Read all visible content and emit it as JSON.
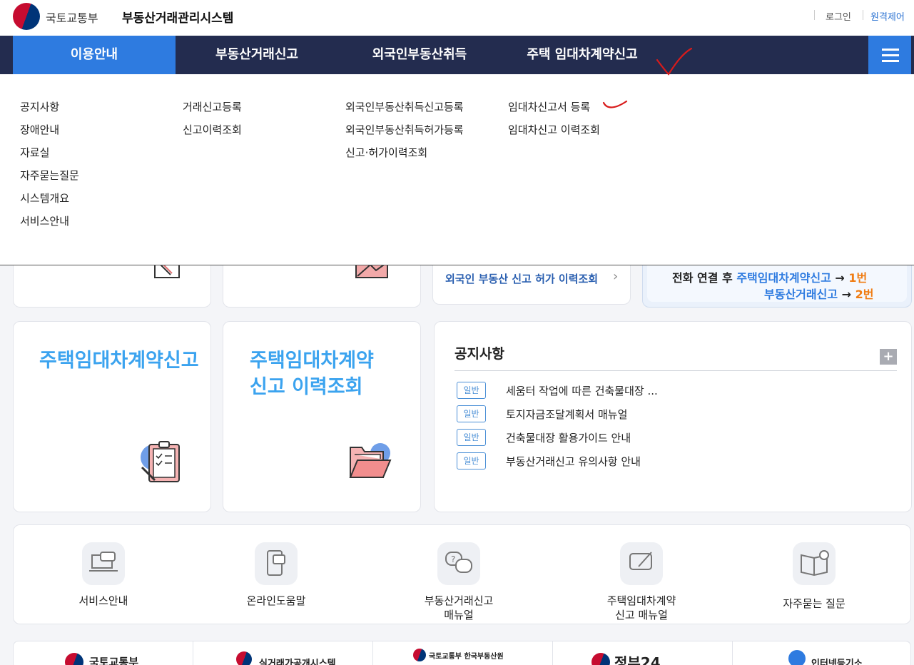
{
  "header": {
    "ministry": "국토교통부",
    "system_title": "부동산거래관리시스템",
    "login": "로그인",
    "remote": "원격제어"
  },
  "nav": {
    "items": [
      {
        "label": "이용안내"
      },
      {
        "label": "부동산거래신고"
      },
      {
        "label": "외국인부동산취득"
      },
      {
        "label": "주택 임대차계약신고"
      }
    ]
  },
  "dropdown": {
    "col1": [
      "공지사항",
      "장애안내",
      "자료실",
      "자주묻는질문",
      "시스템개요",
      "서비스안내"
    ],
    "col2": [
      "거래신고등록",
      "신고이력조회"
    ],
    "col3": [
      "외국인부동산취득신고등록",
      "외국인부동산취득허가등록",
      "신고·허가이력조회"
    ],
    "col4": [
      "임대차신고서 등록",
      "임대차신고 이력조회"
    ]
  },
  "top_cards": {
    "foreign_link": "외국인 부동산 신고 허가 이력조회",
    "phone": {
      "prefix": "전화 연결 후",
      "line1_service": "주택임대차계약신고",
      "line1_arrow": "→",
      "line1_num": "1번",
      "line2_service": "부동산거래신고",
      "line2_arrow": "→",
      "line2_num": "2번"
    }
  },
  "cards": {
    "lease_report": "주택임대차계약신고",
    "lease_history_1": "주택임대차계약",
    "lease_history_2": "신고 이력조회"
  },
  "notice": {
    "title": "공지사항",
    "plus": "+",
    "items": [
      {
        "badge": "일반",
        "text": "세움터 작업에 따른 건축물대장 ..."
      },
      {
        "badge": "일반",
        "text": "토지자금조달계획서 매뉴얼"
      },
      {
        "badge": "일반",
        "text": "건축물대장 활용가이드 안내"
      },
      {
        "badge": "일반",
        "text": "부동산거래신고 유의사항 안내"
      }
    ]
  },
  "quick_links": [
    {
      "label": "서비스안내",
      "icon": "laptop-chat-icon"
    },
    {
      "label": "온라인도움말",
      "icon": "mobile-chat-icon"
    },
    {
      "label": "부동산거래신고\n매뉴얼",
      "icon": "question-chat-icon"
    },
    {
      "label": "주택임대차계약\n신고 매뉴얼",
      "icon": "pen-chat-icon"
    },
    {
      "label": "자주묻는 질문",
      "icon": "book-info-icon"
    }
  ],
  "banners": [
    "국토교통부",
    "실거래가공개시스템",
    "국토교통부 한국부동산원",
    "정부24",
    "인터넷등기소"
  ],
  "colors": {
    "nav_bg": "#232c4f",
    "active": "#2e7be0",
    "title_blue": "#3ba3ef",
    "accent_orange": "#f07c12"
  }
}
